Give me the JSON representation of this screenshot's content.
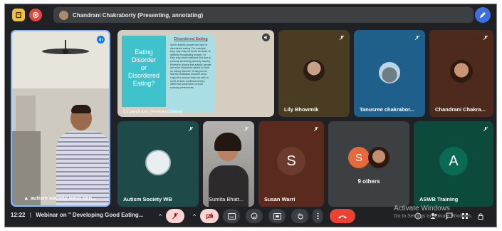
{
  "topbar": {
    "presenting_text": "Chandrani Chakraborty (Presenting, annotating)"
  },
  "slide": {
    "title_lines": [
      "Eating",
      "Disorder",
      "or",
      "Disordered",
      "Eating?"
    ],
    "card_title": "Disordered Eating",
    "card_text": "Some autistic people use rigid or disordered eating. For example, they may only eat foods because of difficulty recognising hunger. Or they may have restricted diet due to sensory sensitivity (sensory issues). Research shows that autistic people are more likely than others to have an eating disorder. It may just be that the individual requires extra support to ensure they are able to meet all their nutritional needs, within the parameters of their sensory preferences.",
    "overlay_name": "Chandrani (Presentation)"
  },
  "tiles": {
    "pinned": "autism society west ben...",
    "lily": "Lily Bhowmik",
    "tanusree": "Tanusree chakrabor...",
    "chandrani": "Chandrani Chakra...",
    "autism_wb": "Autism Society WB",
    "susmita": "Sumita Bhatt...",
    "susan": "Susan Warri",
    "susan_letter": "S",
    "others": "9 others",
    "others_letter": "S",
    "aswb": "ASWB Training",
    "aswb_letter": "A"
  },
  "bottombar": {
    "time": "12:22",
    "separator": "|",
    "meeting_title": "Webinar on \" Developing Good Eating..."
  },
  "watermark": {
    "title": "Activate Windows",
    "subtitle": "Go to Settings to activate Windows."
  },
  "colors": {
    "meet_bg": "#202124",
    "end_call": "#ea4335",
    "accent_blue": "#3d6fe0"
  }
}
